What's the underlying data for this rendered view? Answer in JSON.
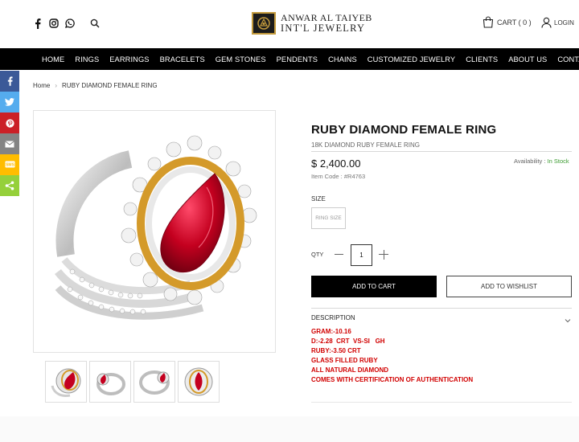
{
  "header": {
    "logo_line1": "ANWAR AL TAIYEB",
    "logo_line2": "INT'L JEWELRY",
    "cart_label": "CART ( 0 )",
    "login_label": "LOGIN",
    "social_icons": [
      "facebook-icon",
      "instagram-icon",
      "whatsapp-icon"
    ],
    "accent_gold": "#c39a3c"
  },
  "nav": {
    "items": [
      "HOME",
      "RINGS",
      "EARRINGS",
      "BRACELETS",
      "GEM STONES",
      "PENDENTS",
      "CHAINS",
      "CUSTOMIZED JEWELRY",
      "CLIENTS",
      "ABOUT US",
      "CONTACT US"
    ]
  },
  "share": {
    "buttons": [
      {
        "icon": "facebook-icon",
        "color": "#3b5998"
      },
      {
        "icon": "twitter-icon",
        "color": "#55acee"
      },
      {
        "icon": "pinterest-icon",
        "color": "#cb2027"
      },
      {
        "icon": "email-icon",
        "color": "#848484"
      },
      {
        "icon": "sms-icon",
        "color": "#ffbd00"
      },
      {
        "icon": "share-icon",
        "color": "#95d03a"
      }
    ]
  },
  "breadcrumb": {
    "home": "Home",
    "sep": "›",
    "current": "RUBY DIAMOND FEMALE RING"
  },
  "product": {
    "title": "RUBY DIAMOND FEMALE RING",
    "subtitle": "18K DIAMOND RUBY FEMALE RING",
    "price": "$ 2,400.00",
    "availability_label": "Availability :",
    "availability_value": "In Stock",
    "item_code": "Item Code : #R4763",
    "size_label": "SIZE",
    "size_option": "RING SIZE",
    "qty_label": "QTY",
    "qty_value": "1",
    "add_to_cart": "ADD TO CART",
    "add_to_wishlist": "ADD TO WISHLIST",
    "description_label": "DESCRIPTION",
    "description_lines": [
      "GRAM:-10.16",
      "D:-2.28  CRT  VS-SI   GH",
      "RUBY:-3.50 CRT",
      "GLASS FILLED RUBY",
      "ALL NATURAL DIAMOND",
      "COMES WITH CERTIFICATION OF AUTHENTICATION"
    ],
    "description_color": "#d10000",
    "in_stock_color": "#3a9a2f"
  }
}
